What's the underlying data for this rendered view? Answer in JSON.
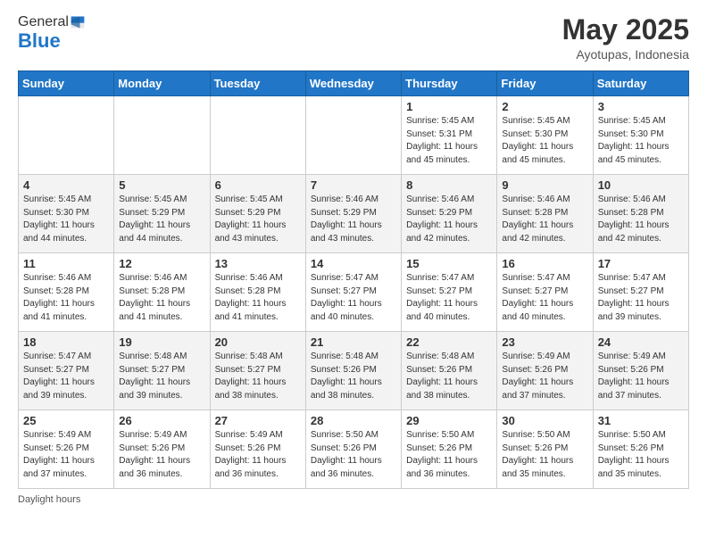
{
  "header": {
    "logo_general": "General",
    "logo_blue": "Blue",
    "title": "May 2025",
    "subtitle": "Ayotupas, Indonesia"
  },
  "days_of_week": [
    "Sunday",
    "Monday",
    "Tuesday",
    "Wednesday",
    "Thursday",
    "Friday",
    "Saturday"
  ],
  "weeks": [
    [
      {
        "day": "",
        "info": ""
      },
      {
        "day": "",
        "info": ""
      },
      {
        "day": "",
        "info": ""
      },
      {
        "day": "",
        "info": ""
      },
      {
        "day": "1",
        "info": "Sunrise: 5:45 AM\nSunset: 5:31 PM\nDaylight: 11 hours\nand 45 minutes."
      },
      {
        "day": "2",
        "info": "Sunrise: 5:45 AM\nSunset: 5:30 PM\nDaylight: 11 hours\nand 45 minutes."
      },
      {
        "day": "3",
        "info": "Sunrise: 5:45 AM\nSunset: 5:30 PM\nDaylight: 11 hours\nand 45 minutes."
      }
    ],
    [
      {
        "day": "4",
        "info": "Sunrise: 5:45 AM\nSunset: 5:30 PM\nDaylight: 11 hours\nand 44 minutes."
      },
      {
        "day": "5",
        "info": "Sunrise: 5:45 AM\nSunset: 5:29 PM\nDaylight: 11 hours\nand 44 minutes."
      },
      {
        "day": "6",
        "info": "Sunrise: 5:45 AM\nSunset: 5:29 PM\nDaylight: 11 hours\nand 43 minutes."
      },
      {
        "day": "7",
        "info": "Sunrise: 5:46 AM\nSunset: 5:29 PM\nDaylight: 11 hours\nand 43 minutes."
      },
      {
        "day": "8",
        "info": "Sunrise: 5:46 AM\nSunset: 5:29 PM\nDaylight: 11 hours\nand 42 minutes."
      },
      {
        "day": "9",
        "info": "Sunrise: 5:46 AM\nSunset: 5:28 PM\nDaylight: 11 hours\nand 42 minutes."
      },
      {
        "day": "10",
        "info": "Sunrise: 5:46 AM\nSunset: 5:28 PM\nDaylight: 11 hours\nand 42 minutes."
      }
    ],
    [
      {
        "day": "11",
        "info": "Sunrise: 5:46 AM\nSunset: 5:28 PM\nDaylight: 11 hours\nand 41 minutes."
      },
      {
        "day": "12",
        "info": "Sunrise: 5:46 AM\nSunset: 5:28 PM\nDaylight: 11 hours\nand 41 minutes."
      },
      {
        "day": "13",
        "info": "Sunrise: 5:46 AM\nSunset: 5:28 PM\nDaylight: 11 hours\nand 41 minutes."
      },
      {
        "day": "14",
        "info": "Sunrise: 5:47 AM\nSunset: 5:27 PM\nDaylight: 11 hours\nand 40 minutes."
      },
      {
        "day": "15",
        "info": "Sunrise: 5:47 AM\nSunset: 5:27 PM\nDaylight: 11 hours\nand 40 minutes."
      },
      {
        "day": "16",
        "info": "Sunrise: 5:47 AM\nSunset: 5:27 PM\nDaylight: 11 hours\nand 40 minutes."
      },
      {
        "day": "17",
        "info": "Sunrise: 5:47 AM\nSunset: 5:27 PM\nDaylight: 11 hours\nand 39 minutes."
      }
    ],
    [
      {
        "day": "18",
        "info": "Sunrise: 5:47 AM\nSunset: 5:27 PM\nDaylight: 11 hours\nand 39 minutes."
      },
      {
        "day": "19",
        "info": "Sunrise: 5:48 AM\nSunset: 5:27 PM\nDaylight: 11 hours\nand 39 minutes."
      },
      {
        "day": "20",
        "info": "Sunrise: 5:48 AM\nSunset: 5:27 PM\nDaylight: 11 hours\nand 38 minutes."
      },
      {
        "day": "21",
        "info": "Sunrise: 5:48 AM\nSunset: 5:26 PM\nDaylight: 11 hours\nand 38 minutes."
      },
      {
        "day": "22",
        "info": "Sunrise: 5:48 AM\nSunset: 5:26 PM\nDaylight: 11 hours\nand 38 minutes."
      },
      {
        "day": "23",
        "info": "Sunrise: 5:49 AM\nSunset: 5:26 PM\nDaylight: 11 hours\nand 37 minutes."
      },
      {
        "day": "24",
        "info": "Sunrise: 5:49 AM\nSunset: 5:26 PM\nDaylight: 11 hours\nand 37 minutes."
      }
    ],
    [
      {
        "day": "25",
        "info": "Sunrise: 5:49 AM\nSunset: 5:26 PM\nDaylight: 11 hours\nand 37 minutes."
      },
      {
        "day": "26",
        "info": "Sunrise: 5:49 AM\nSunset: 5:26 PM\nDaylight: 11 hours\nand 36 minutes."
      },
      {
        "day": "27",
        "info": "Sunrise: 5:49 AM\nSunset: 5:26 PM\nDaylight: 11 hours\nand 36 minutes."
      },
      {
        "day": "28",
        "info": "Sunrise: 5:50 AM\nSunset: 5:26 PM\nDaylight: 11 hours\nand 36 minutes."
      },
      {
        "day": "29",
        "info": "Sunrise: 5:50 AM\nSunset: 5:26 PM\nDaylight: 11 hours\nand 36 minutes."
      },
      {
        "day": "30",
        "info": "Sunrise: 5:50 AM\nSunset: 5:26 PM\nDaylight: 11 hours\nand 35 minutes."
      },
      {
        "day": "31",
        "info": "Sunrise: 5:50 AM\nSunset: 5:26 PM\nDaylight: 11 hours\nand 35 minutes."
      }
    ]
  ],
  "footer": {
    "daylight_label": "Daylight hours"
  }
}
